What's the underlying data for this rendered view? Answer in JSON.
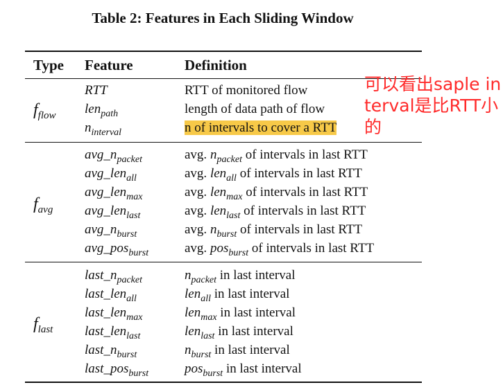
{
  "title": "Table 2: Features in Each Sliding Window",
  "headers": {
    "type": "Type",
    "feature": "Feature",
    "definition": "Definition"
  },
  "groups": [
    {
      "type_base": "f",
      "type_sub": "flow",
      "rows": [
        {
          "f_base": "RTT",
          "f_sub": "",
          "d_pre": "RTT of monitored flow",
          "d_i": "",
          "d_sub": "",
          "d_post": ""
        },
        {
          "f_base": "len",
          "f_sub": "path",
          "d_pre": "length of data path of flow",
          "d_i": "",
          "d_sub": "",
          "d_post": ""
        },
        {
          "f_base": "n",
          "f_sub": "interval",
          "d_pre": "n of intervals to cover a RTT",
          "d_i": "",
          "d_sub": "",
          "d_post": ""
        }
      ]
    },
    {
      "type_base": "f",
      "type_sub": "avg",
      "rows": [
        {
          "f_base": "avg_n",
          "f_sub": "packet",
          "d_pre": "avg. ",
          "d_i": "n",
          "d_sub": "packet",
          "d_post": " of intervals in last RTT"
        },
        {
          "f_base": "avg_len",
          "f_sub": "all",
          "d_pre": "avg. ",
          "d_i": "len",
          "d_sub": "all",
          "d_post": " of intervals in last RTT"
        },
        {
          "f_base": "avg_len",
          "f_sub": "max",
          "d_pre": "avg. ",
          "d_i": "len",
          "d_sub": "max",
          "d_post": " of intervals in last RTT"
        },
        {
          "f_base": "avg_len",
          "f_sub": "last",
          "d_pre": "avg. ",
          "d_i": "len",
          "d_sub": "last",
          "d_post": " of intervals in last RTT"
        },
        {
          "f_base": "avg_n",
          "f_sub": "burst",
          "d_pre": "avg. ",
          "d_i": "n",
          "d_sub": "burst",
          "d_post": " of intervals in last RTT"
        },
        {
          "f_base": "avg_pos",
          "f_sub": "burst",
          "d_pre": "avg. ",
          "d_i": "pos",
          "d_sub": "burst",
          "d_post": " of intervals in last RTT"
        }
      ]
    },
    {
      "type_base": "f",
      "type_sub": "last",
      "rows": [
        {
          "f_base": "last_n",
          "f_sub": "packet",
          "d_pre": "",
          "d_i": "n",
          "d_sub": "packet",
          "d_post": " in last interval"
        },
        {
          "f_base": "last_len",
          "f_sub": "all",
          "d_pre": "",
          "d_i": "len",
          "d_sub": "all",
          "d_post": " in last interval"
        },
        {
          "f_base": "last_len",
          "f_sub": "max",
          "d_pre": "",
          "d_i": "len",
          "d_sub": "max",
          "d_post": " in last interval"
        },
        {
          "f_base": "last_len",
          "f_sub": "last",
          "d_pre": "",
          "d_i": "len",
          "d_sub": "last",
          "d_post": " in last interval"
        },
        {
          "f_base": "last_n",
          "f_sub": "burst",
          "d_pre": "",
          "d_i": "n",
          "d_sub": "burst",
          "d_post": " in last interval"
        },
        {
          "f_base": "last_pos",
          "f_sub": "burst",
          "d_pre": "",
          "d_i": "pos",
          "d_sub": "burst",
          "d_post": " in last interval"
        }
      ]
    }
  ],
  "highlight_color": "#f7c948",
  "annotation": {
    "text": "可以看出saple interval是比RTT小的",
    "color": "#ff2a2a"
  }
}
